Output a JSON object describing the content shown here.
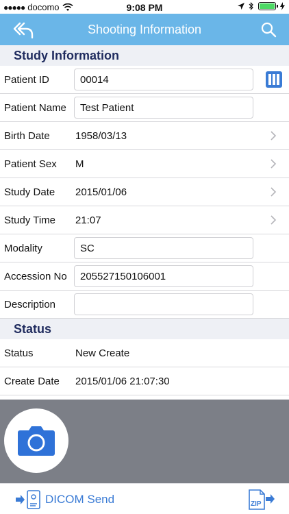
{
  "status_bar": {
    "carrier": "docomo",
    "time": "9:08 PM"
  },
  "nav": {
    "title": "Shooting Information",
    "back_icon": "back-arrow-icon",
    "search_icon": "search-icon"
  },
  "study": {
    "header": "Study Information",
    "rows": [
      {
        "label": "Patient ID",
        "value": "00014",
        "kind": "input",
        "accessory": "barcode"
      },
      {
        "label": "Patient Name",
        "value": "Test Patient",
        "kind": "input"
      },
      {
        "label": "Birth Date",
        "value": "1958/03/13",
        "kind": "disclosure"
      },
      {
        "label": "Patient Sex",
        "value": "M",
        "kind": "disclosure"
      },
      {
        "label": "Study Date",
        "value": "2015/01/06",
        "kind": "disclosure"
      },
      {
        "label": "Study Time",
        "value": "21:07",
        "kind": "disclosure"
      },
      {
        "label": "Modality",
        "value": "SC",
        "kind": "input"
      },
      {
        "label": "Accession No",
        "value": "205527150106001",
        "kind": "input"
      },
      {
        "label": "Description",
        "value": "",
        "kind": "input"
      }
    ]
  },
  "status": {
    "header": "Status",
    "rows": [
      {
        "label": "Status",
        "value": "New Create"
      },
      {
        "label": "Create Date",
        "value": "2015/01/06 21:07:30"
      }
    ]
  },
  "toolbar": {
    "dicom_send_label": "DICOM Send",
    "zip_label": "ZIP"
  },
  "colors": {
    "nav_bar": "#6ab6e8",
    "accent": "#3a7bd5",
    "section_text": "#1f2b5e"
  }
}
